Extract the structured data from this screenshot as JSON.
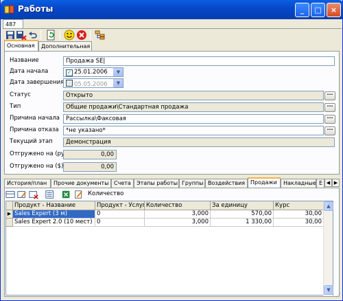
{
  "window": {
    "title": "Работы"
  },
  "doc_tab": "487",
  "primary_tabs": [
    {
      "label": "Основная",
      "active": true
    },
    {
      "label": "Дополнительная",
      "active": false
    }
  ],
  "form": {
    "name_label": "Название",
    "name_value": "Продажа SE|",
    "start_label": "Дата начала",
    "start_value": "25.01.2006",
    "end_label": "Дата завершения",
    "end_value": "05.05.2006",
    "status_label": "Статус",
    "status_value": "Открыто",
    "type_label": "Тип",
    "type_value": "Общие продажи\\Стандартная продажа",
    "reason_start_label": "Причина начала",
    "reason_start_value": "Рассылка\\Факсовая",
    "reason_refuse_label": "Причина отказа",
    "reason_refuse_value": "*не указано*",
    "stage_label": "Текущий этап",
    "stage_value": "Демонстрация",
    "shipped_rub_label": "Отгружено на (руб)",
    "shipped_rub_value": "0,00",
    "shipped_usd_label": "Отгружено на ($)",
    "shipped_usd_value": "0,00"
  },
  "bottom_tabs": [
    {
      "label": "История/план",
      "active": false
    },
    {
      "label": "Прочие документы",
      "active": false
    },
    {
      "label": "Счета",
      "active": false
    },
    {
      "label": "Этапы работы",
      "active": false
    },
    {
      "label": "Группы",
      "active": false
    },
    {
      "label": "Воздействия",
      "active": false
    },
    {
      "label": "Продажи",
      "active": true
    },
    {
      "label": "Накладные",
      "active": false
    },
    {
      "label": "Е",
      "active": false
    }
  ],
  "grid_toolbar": {
    "quantity_label": "Количество"
  },
  "grid": {
    "columns": [
      "Продукт - Название",
      "Продукт - Услуга",
      "Количество",
      "За единицу",
      "Курс"
    ],
    "rows": [
      [
        "Sales Expert (3 м)",
        "0",
        "3,000",
        "570,00",
        "30,00"
      ],
      [
        "Sales Expert 2.0 (10 мест)",
        "0",
        "3,000",
        "1 330,00",
        "30,00"
      ]
    ]
  },
  "colors": {
    "titlebar": "#0848c9",
    "selection": "#316ac5",
    "active_tab_accent": "#f7b046"
  }
}
